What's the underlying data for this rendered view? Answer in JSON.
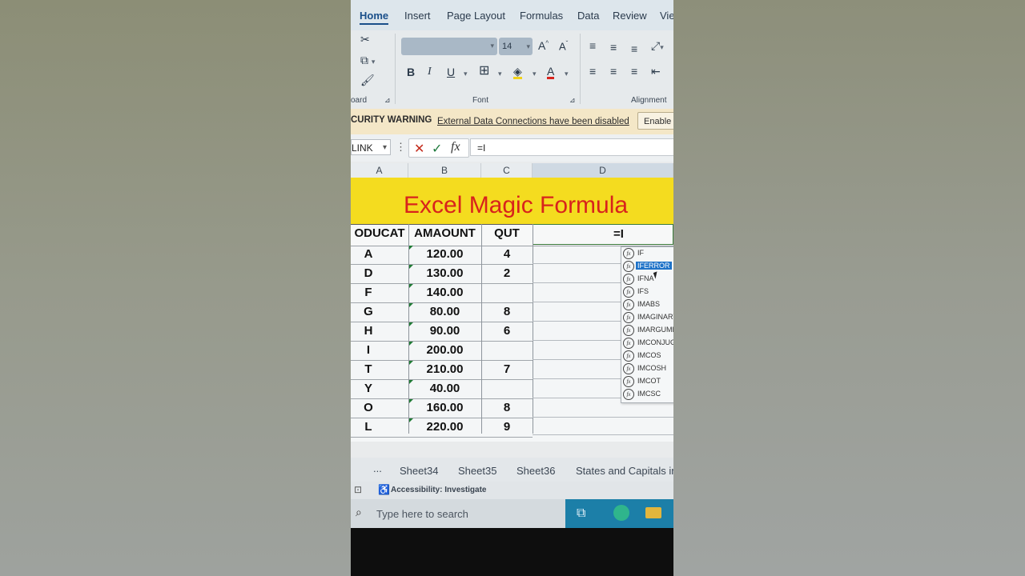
{
  "ribbon": {
    "tabs": [
      "Home",
      "Insert",
      "Page Layout",
      "Formulas",
      "Data",
      "Review",
      "Vie"
    ],
    "active_tab": "Home",
    "font_size": "14",
    "group_labels": {
      "clipboard": "oard",
      "font": "Font",
      "alignment": "Alignment"
    }
  },
  "security_warning": {
    "title": "CURITY WARNING",
    "message": "External Data Connections have been disabled",
    "button": "Enable"
  },
  "formula_bar": {
    "name_box": "LINK",
    "formula": "=I"
  },
  "columns": [
    "A",
    "B",
    "C",
    "D"
  ],
  "sheet": {
    "banner": "Excel Magic Formula",
    "headers": [
      "ODUCAT",
      "AMAOUNT",
      "QUT"
    ],
    "active_cell_text": "=I",
    "rows": [
      {
        "cat": "A",
        "amount": "120.00",
        "qty": "4"
      },
      {
        "cat": "D",
        "amount": "130.00",
        "qty": "2"
      },
      {
        "cat": "F",
        "amount": "140.00",
        "qty": ""
      },
      {
        "cat": "G",
        "amount": "80.00",
        "qty": "8"
      },
      {
        "cat": "H",
        "amount": "90.00",
        "qty": "6"
      },
      {
        "cat": "I",
        "amount": "200.00",
        "qty": ""
      },
      {
        "cat": "T",
        "amount": "210.00",
        "qty": "7"
      },
      {
        "cat": "Y",
        "amount": "40.00",
        "qty": ""
      },
      {
        "cat": "O",
        "amount": "160.00",
        "qty": "8"
      },
      {
        "cat": "L",
        "amount": "220.00",
        "qty": "9"
      }
    ]
  },
  "autocomplete": {
    "icon_text": "fx",
    "selected": "IFERROR",
    "items": [
      "IF",
      "IFERROR",
      "IFNA",
      "IFS",
      "IMABS",
      "IMAGINARY",
      "IMARGUMENT",
      "IMCONJUGATE",
      "IMCOS",
      "IMCOSH",
      "IMCOT",
      "IMCSC"
    ]
  },
  "sheet_tabs": [
    "...",
    "Sheet34",
    "Sheet35",
    "Sheet36",
    "States and Capitals in"
  ],
  "status_bar": {
    "accessibility": "Accessibility: Investigate"
  },
  "taskbar": {
    "search_placeholder": "Type here to search"
  },
  "colors": {
    "banner_bg": "#f4dc1f",
    "banner_text": "#d8231c",
    "selection": "#1f73c8",
    "security_bar": "#f4e7c7"
  }
}
